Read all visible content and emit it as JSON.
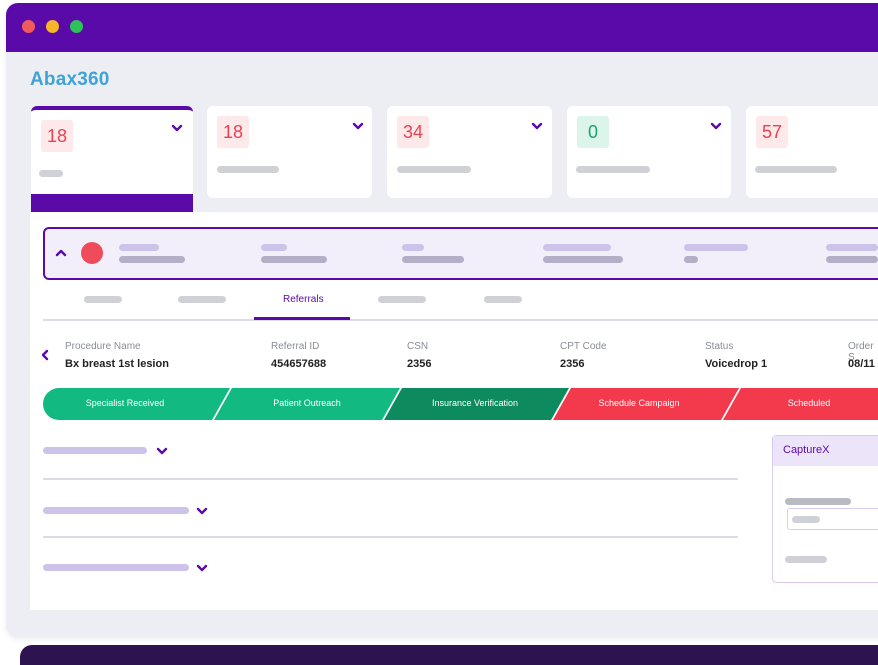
{
  "window": {
    "controls": [
      {
        "name": "close",
        "color": "#f05a5a"
      },
      {
        "name": "minimize",
        "color": "#f6b52b"
      },
      {
        "name": "maximize",
        "color": "#2dc15a"
      }
    ]
  },
  "app": {
    "brand": "Abax360"
  },
  "summary_cards": [
    {
      "count": "18",
      "tone": "red",
      "active": true
    },
    {
      "count": "18",
      "tone": "red",
      "active": false
    },
    {
      "count": "34",
      "tone": "red",
      "active": false
    },
    {
      "count": "0",
      "tone": "green",
      "active": false
    },
    {
      "count": "57",
      "tone": "red",
      "active": false
    }
  ],
  "tabs": {
    "active_label": "Referrals"
  },
  "referral": {
    "fields": [
      {
        "label": "Procedure Name",
        "value": "Bx breast 1st lesion"
      },
      {
        "label": "Referral ID",
        "value": "454657688"
      },
      {
        "label": "CSN",
        "value": "2356"
      },
      {
        "label": "CPT Code",
        "value": "2356"
      },
      {
        "label": "Status",
        "value": "Voicedrop 1"
      },
      {
        "label": "Order S",
        "value": "08/11"
      }
    ]
  },
  "stages": [
    {
      "label": "Specialist Received",
      "color": "#12b981"
    },
    {
      "label": "Patient Outreach",
      "color": "#12b981"
    },
    {
      "label": "Insurance Verification",
      "color": "#0e8a5f"
    },
    {
      "label": "Schedule Campaign",
      "color": "#f23a4c"
    },
    {
      "label": "Scheduled",
      "color": "#f23a4c"
    }
  ],
  "side_panel": {
    "title": "CaptureX"
  },
  "colors": {
    "accent": "#5a0aa8",
    "brand_text": "#3fa3d6"
  }
}
